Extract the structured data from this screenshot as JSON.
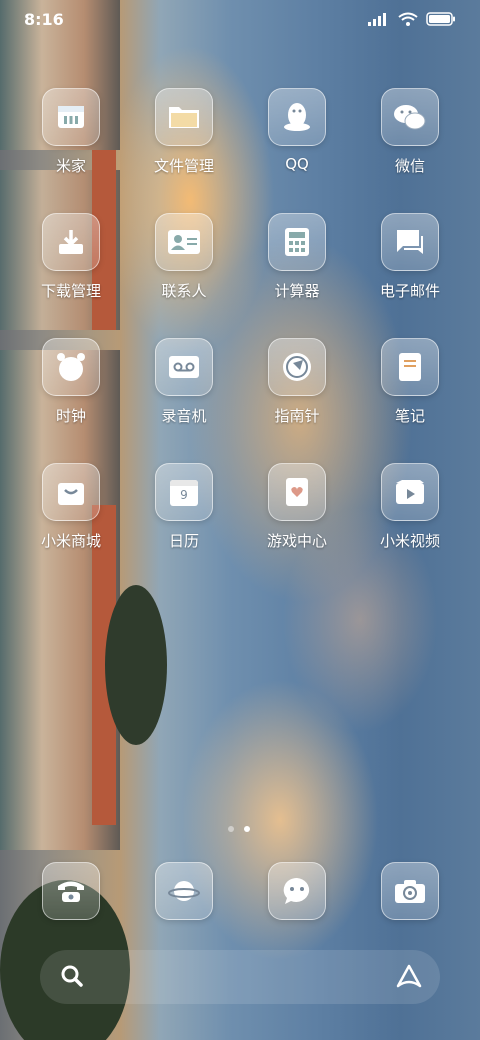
{
  "status_bar": {
    "time": "8:16",
    "icons": [
      "signal-icon",
      "wifi-icon",
      "battery-icon"
    ]
  },
  "apps": [
    {
      "name": "mijia",
      "label": "米家",
      "icon": "mijia-icon"
    },
    {
      "name": "file-manager",
      "label": "文件管理",
      "icon": "folder-icon"
    },
    {
      "name": "qq",
      "label": "QQ",
      "icon": "penguin-icon"
    },
    {
      "name": "wechat",
      "label": "微信",
      "icon": "chat-bubbles-icon"
    },
    {
      "name": "downloads",
      "label": "下载管理",
      "icon": "download-icon"
    },
    {
      "name": "contacts",
      "label": "联系人",
      "icon": "contact-card-icon"
    },
    {
      "name": "calculator",
      "label": "计算器",
      "icon": "calculator-icon"
    },
    {
      "name": "email",
      "label": "电子邮件",
      "icon": "message-icon"
    },
    {
      "name": "clock",
      "label": "时钟",
      "icon": "alarm-clock-icon"
    },
    {
      "name": "recorder",
      "label": "录音机",
      "icon": "cassette-icon"
    },
    {
      "name": "compass",
      "label": "指南针",
      "icon": "compass-icon"
    },
    {
      "name": "notes",
      "label": "笔记",
      "icon": "notepad-icon"
    },
    {
      "name": "mi-store",
      "label": "小米商城",
      "icon": "shopping-bag-icon"
    },
    {
      "name": "calendar",
      "label": "日历",
      "icon": "calendar-icon",
      "date_text": "9"
    },
    {
      "name": "game-center",
      "label": "游戏中心",
      "icon": "game-card-icon"
    },
    {
      "name": "mi-video",
      "label": "小米视频",
      "icon": "video-play-icon"
    }
  ],
  "page_indicator": {
    "pages": 2,
    "active": 2
  },
  "dock": [
    {
      "name": "phone",
      "icon": "telephone-icon"
    },
    {
      "name": "browser",
      "icon": "planet-icon"
    },
    {
      "name": "messages",
      "icon": "smiley-bubble-icon"
    },
    {
      "name": "camera",
      "icon": "camera-icon"
    }
  ],
  "search_bar": {
    "search_icon": "search-icon",
    "assistant_icon": "assistant-icon"
  }
}
